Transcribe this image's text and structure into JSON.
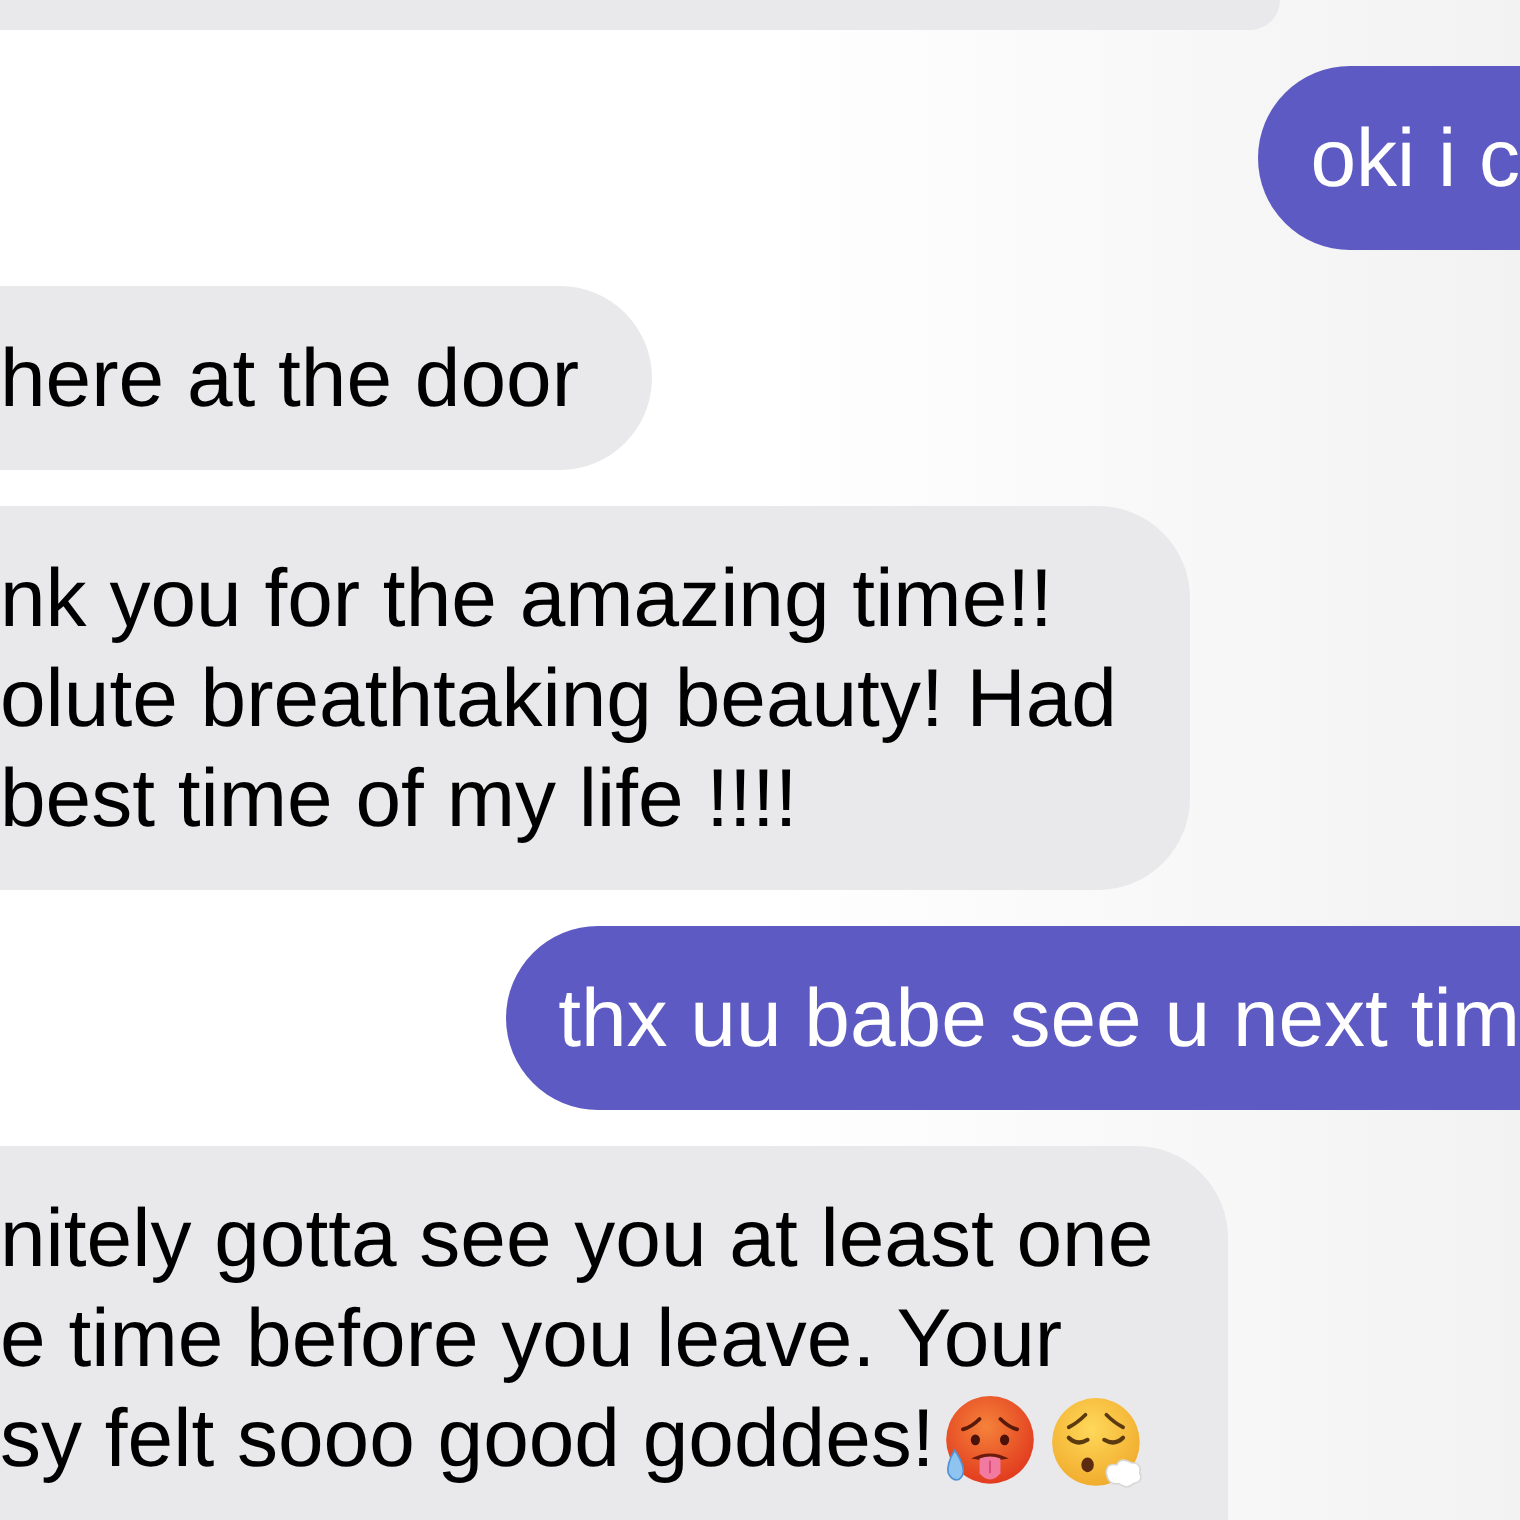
{
  "messages": [
    {
      "kind": "received"
    },
    {
      "kind": "sent",
      "lines": [
        "oki i c"
      ]
    },
    {
      "kind": "received",
      "lines": [
        "here at the door"
      ]
    },
    {
      "kind": "received",
      "lines": [
        "nk you for the amazing time!!",
        "olute breathtaking beauty! Had",
        "best time of my life !!!!"
      ]
    },
    {
      "kind": "sent",
      "lines": [
        "thx uu babe see u next tim"
      ]
    },
    {
      "kind": "received",
      "lines": [
        "nitely gotta see you at least one",
        "e time before you leave. Your",
        "sy felt sooo good goddes!"
      ],
      "emoji": [
        {
          "kind": "hot_face"
        },
        {
          "kind": "exhaling_face"
        }
      ]
    }
  ]
}
